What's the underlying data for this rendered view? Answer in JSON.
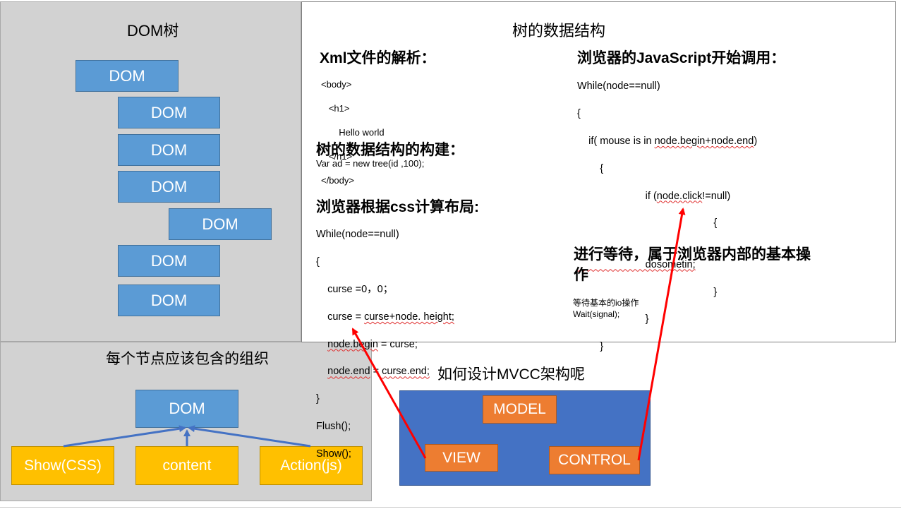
{
  "dom_tree_panel": {
    "title": "DOM树",
    "nodes": [
      "DOM",
      "DOM",
      "DOM",
      "DOM",
      "DOM",
      "DOM",
      "DOM"
    ]
  },
  "node_panel": {
    "title": "每个节点应该包含的组织",
    "root": "DOM",
    "children": [
      "Show(CSS)",
      "content",
      "Action(js)"
    ]
  },
  "data_panel": {
    "title": "树的数据结构",
    "xml_heading": "Xml文件的解析：",
    "xml_lines": [
      "<body>",
      "   <h1>",
      "       Hello world",
      "   </h1>",
      "</body>"
    ],
    "build_heading": "树的数据结构的构建：",
    "build_code": "Var ad = new tree(id ,100);",
    "layout_heading": "浏览器根据css计算布局:",
    "layout_lines": {
      "l1": "While(node==null)",
      "l2": "{",
      "l3": "    curse =0，0；",
      "l4a": "    curse = ",
      "l4b": "curse+node. height;",
      "l5a": "    ",
      "l5b": "node.begin",
      "l5c": " = curse;",
      "l6a": "    ",
      "l6b": "node.end",
      "l6c": " = ",
      "l6d": "curse.end;",
      "l7": "}",
      "l8": "Flush();",
      "l9": "Show();"
    },
    "js_heading": "浏览器的JavaScript开始调用：",
    "js_lines": {
      "j1": "While(node==null)",
      "j2": "{",
      "j3a": "    if( mouse is in ",
      "j3b": "node.begin+node.end",
      "j3c": ")",
      "j4": "        {",
      "j5a": "                        if (",
      "j5b": "node.click",
      "j5c": "!=null)",
      "j6": "                                                {",
      "j7": "",
      "j8": "                        dosometin;",
      "j9": "                                                }",
      "j10": "                        }",
      "j11": "        }",
      "j12": "}"
    },
    "wait_heading": "进行等待，属于浏览器内部的基本操作",
    "wait_notes": [
      "等待基本的io操作",
      "Wait(signal);"
    ]
  },
  "mvc_panel": {
    "title": "如何设计MVCC架构呢",
    "model": "MODEL",
    "view": "VIEW",
    "control": "CONTROL"
  },
  "colors": {
    "dom_blue": "#5b9bd5",
    "yellow": "#ffc000",
    "orange": "#ed7d31",
    "mvc_blue": "#4472c4",
    "arrow_red": "#ff0000",
    "gray_panel": "#d2d2d2"
  }
}
